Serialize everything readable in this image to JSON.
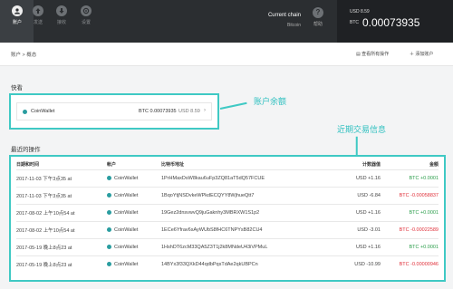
{
  "nav": {
    "items": [
      {
        "label": "账户",
        "icon": "account-icon"
      },
      {
        "label": "发送",
        "icon": "send-icon"
      },
      {
        "label": "接收",
        "icon": "receive-icon"
      },
      {
        "label": "设置",
        "icon": "settings-icon"
      }
    ],
    "current_chain_label": "Current chain",
    "current_chain_value": "Bitcoin",
    "help_label": "帮助",
    "balance_usd": "USD 8.59",
    "balance_btc_unit": "BTC",
    "balance_btc_amount": "0.00073935"
  },
  "breadcrumb": "账户 > 概态",
  "actions": {
    "more": "查看所有操作",
    "add": "添加账户"
  },
  "accounts_title": "快看",
  "wallet": {
    "name": "CoinWallet",
    "btc": "BTC 0.00073935",
    "usd": "USD 8.59"
  },
  "callout_balance": "账户余额",
  "callout_tx": "近期交易信息",
  "recent_title": "最近的操作",
  "table": {
    "headers": [
      "日期和时间",
      "帐户",
      "比特币地址",
      "计数器值",
      "金额"
    ],
    "rows": [
      [
        "2017-11-03 下午3点35 at",
        "CoinWallet",
        "1PrHMaxDsW8kau6uFp3ZQ81aT5dQ57FCUE",
        "USD +1.16",
        "BTC +0.0001"
      ],
      [
        "2017-11-03 下午3点35 at",
        "CoinWallet",
        "1BqoYtjNSDvkeWPkdECQYY8WjhueQtt7",
        "USD -6.84",
        "BTC -0.00058837"
      ],
      [
        "2017-08-02 上午10点54 at",
        "CoinWallet",
        "19Gez2dnsvwvQ9juGaknhy3MBRXW1S1p2",
        "USD +1.16",
        "BTC +0.0001"
      ],
      [
        "2017-08-02 上午10点54 at",
        "CoinWallet",
        "1ECe6Yfrav6sAyWUbS8fHC6TNPYsB82CU4",
        "USD -3.01",
        "BTC -0.00022589"
      ],
      [
        "2017-05-19 晚上8点23 at",
        "CoinWallet",
        "1HshDT6zcM33QA5Z3T1j2k8MNdeU43iVPMuL",
        "USD +1.16",
        "BTC +0.0001"
      ],
      [
        "2017-05-19 晚上8点23 at",
        "CoinWallet",
        "14BYx3f33QXkD44qdbPqsTdAe2qkUBPCn",
        "USD -10.99",
        "BTC -0.00000946"
      ]
    ]
  },
  "colors": {
    "accent": "#3fc9c4",
    "positive": "#2a9d4a",
    "negative": "#e0303a"
  }
}
